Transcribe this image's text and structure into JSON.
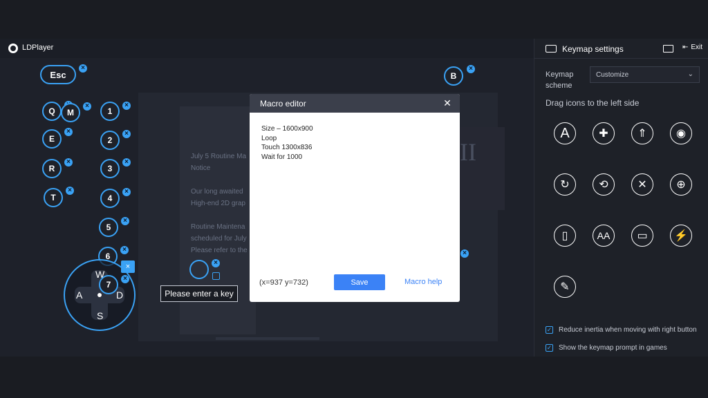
{
  "app": {
    "name": "LDPlayer"
  },
  "keys": {
    "esc": "Esc",
    "b": "B",
    "q": "Q",
    "m": "M",
    "e": "E",
    "r": "R",
    "t": "T",
    "n1": "1",
    "n2": "2",
    "n3": "3",
    "n4": "4",
    "n5": "5",
    "n6": "6",
    "n7": "7"
  },
  "dpad": {
    "up": "W",
    "left": "A",
    "down": "S",
    "right": "D"
  },
  "tooltip": "Please enter a key",
  "background_notice": {
    "lines": [
      "July 5 Routine Ma",
      "Notice",
      "",
      "Our long awaited",
      "High-end 2D grap",
      "",
      "Routine Maintena",
      "scheduled for July",
      "Please refer to the"
    ],
    "glyph": "II"
  },
  "macro_editor": {
    "title": "Macro editor",
    "content": "Size – 1600x900\nLoop\nTouch 1300x836\nWait for 1000",
    "coords": "(x=937  y=732)",
    "save_label": "Save",
    "help_label": "Macro help"
  },
  "panel": {
    "title": "Keymap settings",
    "exit_label": "Exit",
    "scheme_label": "Keymap scheme",
    "scheme_value": "Customize",
    "drag_hint": "Drag icons to the left side",
    "tools": [
      {
        "icon": "letter-a-icon",
        "glyph": "A"
      },
      {
        "icon": "dpad-cross-icon",
        "glyph": "✚"
      },
      {
        "icon": "rocket-icon",
        "glyph": "⇑"
      },
      {
        "icon": "eye-icon",
        "glyph": "◉"
      },
      {
        "icon": "rotate-view-icon",
        "glyph": "↻"
      },
      {
        "icon": "spin-icon",
        "glyph": "⟲"
      },
      {
        "icon": "crossed-swords-icon",
        "glyph": "✕"
      },
      {
        "icon": "crosshair-icon",
        "glyph": "⊕"
      },
      {
        "icon": "mouse-icon",
        "glyph": "▯"
      },
      {
        "icon": "double-a-icon",
        "glyph": "AA"
      },
      {
        "icon": "shake-phone-icon",
        "glyph": "▭"
      },
      {
        "icon": "lightning-icon",
        "glyph": "⚡"
      },
      {
        "icon": "macro-script-icon",
        "glyph": "✎"
      }
    ],
    "options": [
      {
        "label": "Reduce inertia when moving with right button",
        "checked": true
      },
      {
        "label": "Show the keymap prompt in games",
        "checked": true
      }
    ]
  },
  "colors": {
    "accent": "#3aa2f5",
    "save_button": "#3b82f6",
    "dialog_header": "#3b3f4b"
  }
}
